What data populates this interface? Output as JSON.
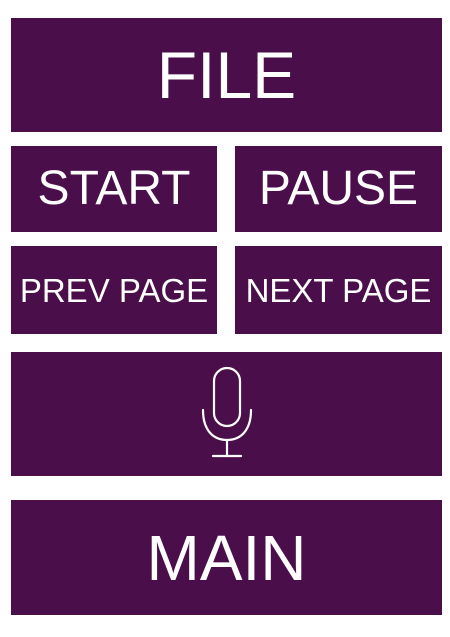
{
  "buttons": {
    "file": "FILE",
    "start": "START",
    "pause": "PAUSE",
    "prev_page": "PREV PAGE",
    "next_page": "NEXT PAGE",
    "main": "MAIN"
  },
  "icons": {
    "microphone": "microphone-icon"
  },
  "colors": {
    "button_bg": "#4a0e4a",
    "button_text": "#ffffff",
    "background": "#ffffff"
  }
}
